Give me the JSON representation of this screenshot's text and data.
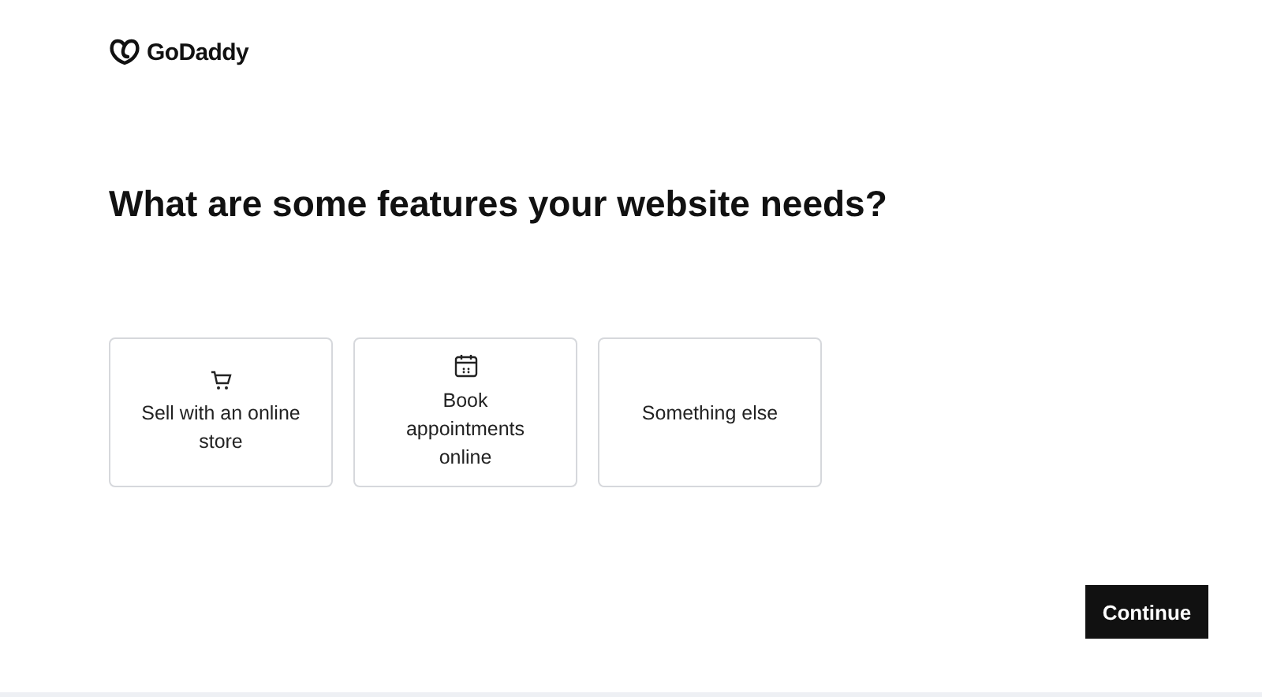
{
  "logo": {
    "text": "GoDaddy"
  },
  "heading": "What are some features your website needs?",
  "options": [
    {
      "label": "Sell with an online store",
      "kind": "cart",
      "selected": false
    },
    {
      "label": "Book appointments online",
      "kind": "calendar",
      "selected": false
    },
    {
      "label": "Something else",
      "kind": "text",
      "selected": false
    }
  ],
  "continue_button": "Continue"
}
